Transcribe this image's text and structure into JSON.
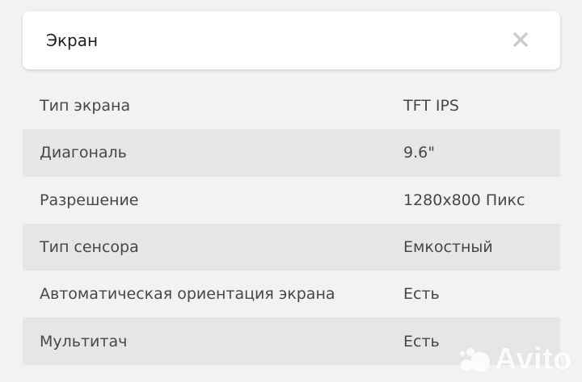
{
  "header": {
    "title": "Экран",
    "close_icon": "close-icon"
  },
  "specs": [
    {
      "name": "Тип экрана",
      "value": "TFT IPS"
    },
    {
      "name": "Диагональ",
      "value": "9.6\""
    },
    {
      "name": "Разрешение",
      "value": "1280x800 Пикс"
    },
    {
      "name": "Тип сенсора",
      "value": "Емкостный"
    },
    {
      "name": "Автоматическая ориентация экрана",
      "value": "Есть"
    },
    {
      "name": "Мультитач",
      "value": "Есть"
    }
  ],
  "watermark": {
    "text": "Avito",
    "icon": "avito-logo-icon"
  },
  "colors": {
    "background": "#f2f2f2",
    "card": "#ffffff",
    "row_shaded": "#e6e6e6",
    "text": "#474747",
    "close_icon": "#cccccc"
  }
}
